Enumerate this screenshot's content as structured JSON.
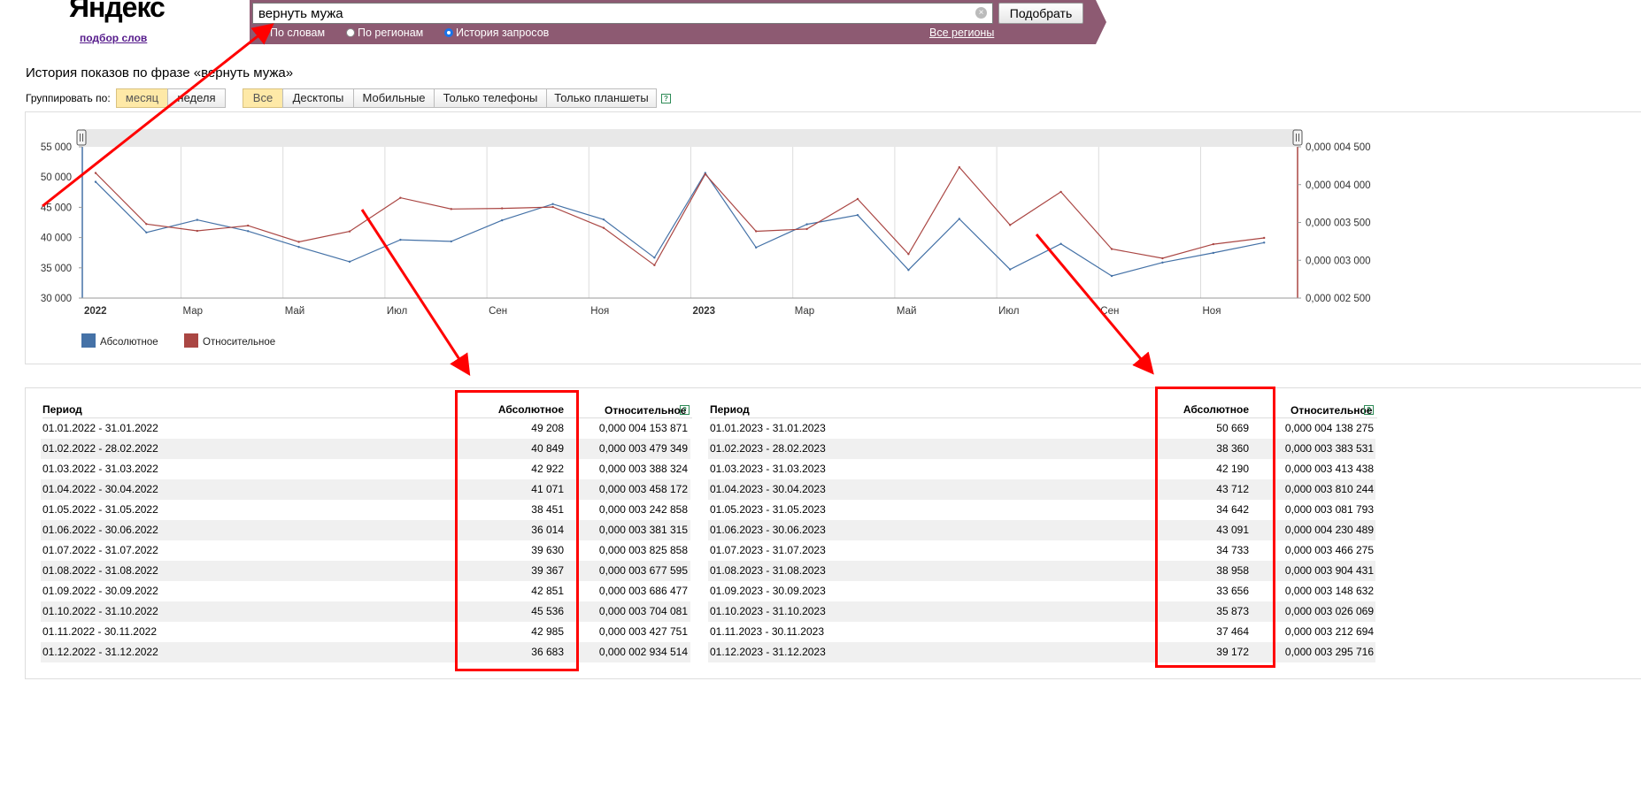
{
  "header": {
    "logo": "Яндекс",
    "service_link": "подбор слов",
    "search_value": "вернуть мужа",
    "search_placeholder": "",
    "submit_label": "Подобрать",
    "radios": [
      {
        "label": "По словам",
        "checked": false
      },
      {
        "label": "По регионам",
        "checked": false
      },
      {
        "label": "История запросов",
        "checked": true
      }
    ],
    "regions_link": "Все регионы"
  },
  "page_title": "История показов по фразе «вернуть мужа»",
  "grouping": {
    "label": "Группировать по:",
    "options": [
      {
        "label": "месяц",
        "active": true
      },
      {
        "label": "неделя",
        "active": false
      }
    ]
  },
  "devices": [
    {
      "label": "Все",
      "active": true
    },
    {
      "label": "Десктопы",
      "active": false
    },
    {
      "label": "Мобильные",
      "active": false
    },
    {
      "label": "Только телефоны",
      "active": false
    },
    {
      "label": "Только планшеты",
      "active": false
    }
  ],
  "help_glyph": "?",
  "colors": {
    "absolute": "#4572a7",
    "relative": "#aa4643",
    "accent_bar": "#8d5a72",
    "annotation": "#ff0000"
  },
  "chart_data": {
    "type": "line",
    "x": [
      "2022",
      "Фев",
      "Мар",
      "Апр",
      "Май",
      "Июн",
      "Июл",
      "Авг",
      "Сен",
      "Окт",
      "Ноя",
      "Дек",
      "2023",
      "Фев",
      "Мар",
      "Апр",
      "Май",
      "Июн",
      "Июл",
      "Авг",
      "Сен",
      "Окт",
      "Ноя",
      "Дек"
    ],
    "x_tick_labels": [
      "2022",
      "Мар",
      "Май",
      "Июл",
      "Сен",
      "Ноя",
      "2023",
      "Мар",
      "Май",
      "Июл",
      "Сен",
      "Ноя"
    ],
    "y_left_ticks": [
      "55 000",
      "50 000",
      "45 000",
      "40 000",
      "35 000",
      "30 000"
    ],
    "y_right_ticks": [
      "0,000 004 500",
      "0,000 004 000",
      "0,000 003 500",
      "0,000 003 000",
      "0,000 002 500"
    ],
    "ylim_left": [
      30000,
      55000
    ],
    "ylim_right": [
      2.5e-06,
      4.5e-06
    ],
    "grid": true,
    "legend_position": "bottom-left",
    "series": [
      {
        "name": "Абсолютное",
        "axis": "left",
        "values": [
          49208,
          40849,
          42922,
          41071,
          38451,
          36014,
          39630,
          39367,
          42851,
          45536,
          42985,
          36683,
          50669,
          38360,
          42190,
          43712,
          34642,
          43091,
          34733,
          38958,
          33656,
          35873,
          37464,
          39172
        ]
      },
      {
        "name": "Относительное",
        "axis": "right",
        "values": [
          4.153871e-06,
          3.479349e-06,
          3.388324e-06,
          3.458172e-06,
          3.242858e-06,
          3.381315e-06,
          3.825858e-06,
          3.677595e-06,
          3.686477e-06,
          3.704081e-06,
          3.427751e-06,
          2.934514e-06,
          4.138275e-06,
          3.383531e-06,
          3.413438e-06,
          3.810244e-06,
          3.081793e-06,
          4.230489e-06,
          3.466275e-06,
          3.904431e-06,
          3.148632e-06,
          3.026069e-06,
          3.212694e-06,
          3.295716e-06
        ]
      }
    ]
  },
  "table": {
    "headers": {
      "period": "Период",
      "absolute": "Абсолютное",
      "relative": "Относительное"
    },
    "left": [
      {
        "period": "01.01.2022 - 31.01.2022",
        "abs": "49 208",
        "rel": "0,000 004 153 871"
      },
      {
        "period": "01.02.2022 - 28.02.2022",
        "abs": "40 849",
        "rel": "0,000 003 479 349"
      },
      {
        "period": "01.03.2022 - 31.03.2022",
        "abs": "42 922",
        "rel": "0,000 003 388 324"
      },
      {
        "period": "01.04.2022 - 30.04.2022",
        "abs": "41 071",
        "rel": "0,000 003 458 172"
      },
      {
        "period": "01.05.2022 - 31.05.2022",
        "abs": "38 451",
        "rel": "0,000 003 242 858"
      },
      {
        "period": "01.06.2022 - 30.06.2022",
        "abs": "36 014",
        "rel": "0,000 003 381 315"
      },
      {
        "period": "01.07.2022 - 31.07.2022",
        "abs": "39 630",
        "rel": "0,000 003 825 858"
      },
      {
        "period": "01.08.2022 - 31.08.2022",
        "abs": "39 367",
        "rel": "0,000 003 677 595"
      },
      {
        "period": "01.09.2022 - 30.09.2022",
        "abs": "42 851",
        "rel": "0,000 003 686 477"
      },
      {
        "period": "01.10.2022 - 31.10.2022",
        "abs": "45 536",
        "rel": "0,000 003 704 081"
      },
      {
        "period": "01.11.2022 - 30.11.2022",
        "abs": "42 985",
        "rel": "0,000 003 427 751"
      },
      {
        "period": "01.12.2022 - 31.12.2022",
        "abs": "36 683",
        "rel": "0,000 002 934 514"
      }
    ],
    "right": [
      {
        "period": "01.01.2023 - 31.01.2023",
        "abs": "50 669",
        "rel": "0,000 004 138 275"
      },
      {
        "period": "01.02.2023 - 28.02.2023",
        "abs": "38 360",
        "rel": "0,000 003 383 531"
      },
      {
        "period": "01.03.2023 - 31.03.2023",
        "abs": "42 190",
        "rel": "0,000 003 413 438"
      },
      {
        "period": "01.04.2023 - 30.04.2023",
        "abs": "43 712",
        "rel": "0,000 003 810 244"
      },
      {
        "period": "01.05.2023 - 31.05.2023",
        "abs": "34 642",
        "rel": "0,000 003 081 793"
      },
      {
        "period": "01.06.2023 - 30.06.2023",
        "abs": "43 091",
        "rel": "0,000 004 230 489"
      },
      {
        "period": "01.07.2023 - 31.07.2023",
        "abs": "34 733",
        "rel": "0,000 003 466 275"
      },
      {
        "period": "01.08.2023 - 31.08.2023",
        "abs": "38 958",
        "rel": "0,000 003 904 431"
      },
      {
        "period": "01.09.2023 - 30.09.2023",
        "abs": "33 656",
        "rel": "0,000 003 148 632"
      },
      {
        "period": "01.10.2023 - 31.10.2023",
        "abs": "35 873",
        "rel": "0,000 003 026 069"
      },
      {
        "period": "01.11.2023 - 30.11.2023",
        "abs": "37 464",
        "rel": "0,000 003 212 694"
      },
      {
        "period": "01.12.2023 - 31.12.2023",
        "abs": "39 172",
        "rel": "0,000 003 295 716"
      }
    ]
  }
}
